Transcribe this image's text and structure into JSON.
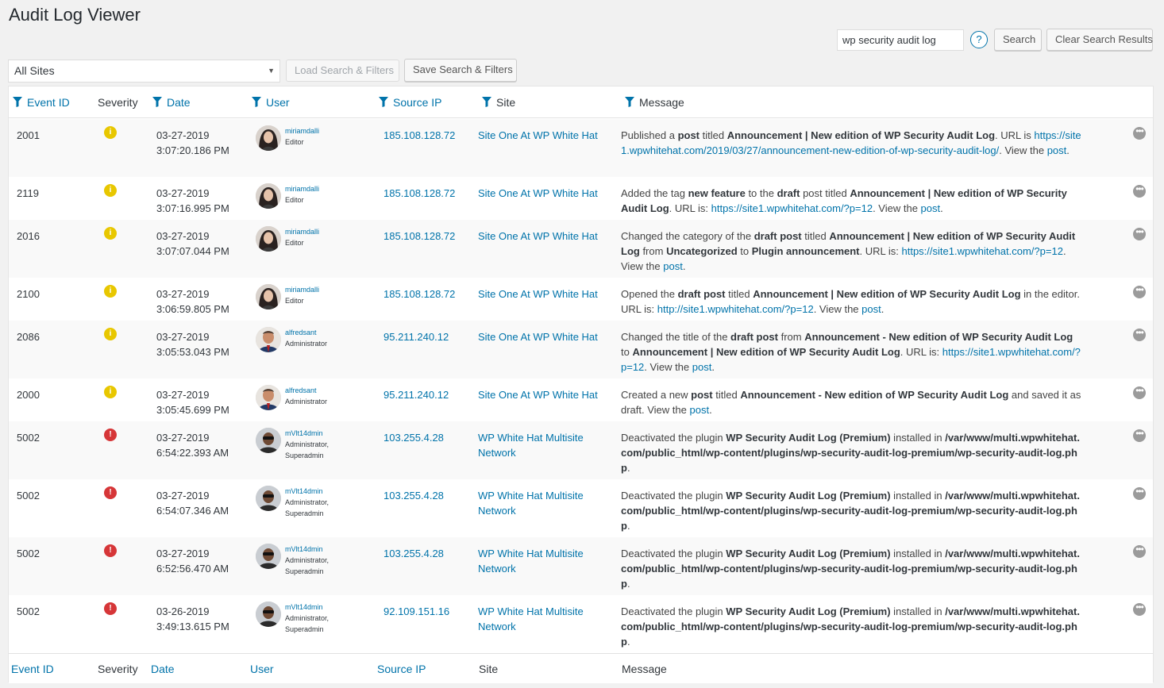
{
  "header": {
    "title": "Audit Log Viewer"
  },
  "search": {
    "value": "wp security audit log",
    "help_label": "?",
    "search_label": "Search",
    "clear_label": "Clear Search Results"
  },
  "filters": {
    "site_select": "All Sites",
    "load_label": "Load Search & Filters",
    "save_label": "Save Search & Filters"
  },
  "columns": {
    "event_id": "Event ID",
    "severity": "Severity",
    "date": "Date",
    "user": "User",
    "source_ip": "Source IP",
    "site": "Site",
    "message": "Message"
  },
  "colors": {
    "link": "#0073aa",
    "info": "#e8c700",
    "critical": "#d63638"
  },
  "rows": [
    {
      "id": "2001",
      "severity": "info",
      "sev_glyph": "i",
      "date": "03-27-2019",
      "time": "3:07:20.186 PM",
      "user": "miriamdalli",
      "role1": "Editor",
      "role2": "",
      "avatar": "woman-avatar",
      "ip": "185.108.128.72",
      "site1": "Site One At WP White Hat",
      "site2": "",
      "msg": [
        {
          "t": "Published a ",
          "s": "plain"
        },
        {
          "t": "post",
          "s": "bold"
        },
        {
          "t": " titled ",
          "s": "plain"
        },
        {
          "t": "Announcement | New edition of WP Security Audit Log",
          "s": "bold"
        },
        {
          "t": ". URL is ",
          "s": "plain"
        },
        {
          "t": "https://site1.wpwhitehat.com/2019/03/27/announcement-new-edition-of-wp-security-audit-log/",
          "s": "link"
        },
        {
          "t": ". View the ",
          "s": "plain"
        },
        {
          "t": "post",
          "s": "link"
        },
        {
          "t": ".",
          "s": "plain"
        }
      ]
    },
    {
      "id": "2119",
      "severity": "info",
      "sev_glyph": "i",
      "date": "03-27-2019",
      "time": "3:07:16.995 PM",
      "user": "miriamdalli",
      "role1": "Editor",
      "role2": "",
      "avatar": "woman-avatar",
      "ip": "185.108.128.72",
      "site1": "Site One At WP White Hat",
      "site2": "",
      "msg": [
        {
          "t": "Added the tag ",
          "s": "plain"
        },
        {
          "t": "new feature",
          "s": "bold"
        },
        {
          "t": " to the ",
          "s": "plain"
        },
        {
          "t": "draft",
          "s": "bold"
        },
        {
          "t": " post titled ",
          "s": "plain"
        },
        {
          "t": "Announcement | New edition of WP Security Audit Log",
          "s": "bold"
        },
        {
          "t": ". URL is: ",
          "s": "plain"
        },
        {
          "t": "https://site1.wpwhitehat.com/?p=12",
          "s": "link"
        },
        {
          "t": ". View the ",
          "s": "plain"
        },
        {
          "t": "post",
          "s": "link"
        },
        {
          "t": ".",
          "s": "plain"
        }
      ]
    },
    {
      "id": "2016",
      "severity": "info",
      "sev_glyph": "i",
      "date": "03-27-2019",
      "time": "3:07:07.044 PM",
      "user": "miriamdalli",
      "role1": "Editor",
      "role2": "",
      "avatar": "woman-avatar",
      "ip": "185.108.128.72",
      "site1": "Site One At WP White Hat",
      "site2": "",
      "msg": [
        {
          "t": "Changed the category of the ",
          "s": "plain"
        },
        {
          "t": "draft post",
          "s": "bold"
        },
        {
          "t": " titled ",
          "s": "plain"
        },
        {
          "t": "Announcement | New edition of WP Security Audit Log",
          "s": "bold"
        },
        {
          "t": " from ",
          "s": "plain"
        },
        {
          "t": "Uncategorized",
          "s": "bold"
        },
        {
          "t": " to ",
          "s": "plain"
        },
        {
          "t": "Plugin announcement",
          "s": "bold"
        },
        {
          "t": ". URL is: ",
          "s": "plain"
        },
        {
          "t": "https://site1.wpwhitehat.com/?p=12",
          "s": "link"
        },
        {
          "t": ". View the ",
          "s": "plain"
        },
        {
          "t": "post",
          "s": "link"
        },
        {
          "t": ".",
          "s": "plain"
        }
      ]
    },
    {
      "id": "2100",
      "severity": "info",
      "sev_glyph": "i",
      "date": "03-27-2019",
      "time": "3:06:59.805 PM",
      "user": "miriamdalli",
      "role1": "Editor",
      "role2": "",
      "avatar": "woman-avatar",
      "ip": "185.108.128.72",
      "site1": "Site One At WP White Hat",
      "site2": "",
      "msg": [
        {
          "t": "Opened the ",
          "s": "plain"
        },
        {
          "t": "draft post",
          "s": "bold"
        },
        {
          "t": " titled ",
          "s": "plain"
        },
        {
          "t": "Announcement | New edition of WP Security Audit Log",
          "s": "bold"
        },
        {
          "t": " in the editor. URL is: ",
          "s": "plain"
        },
        {
          "t": "http://site1.wpwhitehat.com/?p=12",
          "s": "link"
        },
        {
          "t": ". View the ",
          "s": "plain"
        },
        {
          "t": "post",
          "s": "link"
        },
        {
          "t": ".",
          "s": "plain"
        }
      ]
    },
    {
      "id": "2086",
      "severity": "info",
      "sev_glyph": "i",
      "date": "03-27-2019",
      "time": "3:05:53.043 PM",
      "user": "alfredsant",
      "role1": "Administrator",
      "role2": "",
      "avatar": "man-avatar",
      "ip": "95.211.240.12",
      "site1": "Site One At WP White Hat",
      "site2": "",
      "msg": [
        {
          "t": "Changed the title of the ",
          "s": "plain"
        },
        {
          "t": "draft post",
          "s": "bold"
        },
        {
          "t": " from ",
          "s": "plain"
        },
        {
          "t": "Announcement - New edition of WP Security Audit Log",
          "s": "bold"
        },
        {
          "t": " to ",
          "s": "plain"
        },
        {
          "t": "Announcement | New edition of WP Security Audit Log",
          "s": "bold"
        },
        {
          "t": ". URL is: ",
          "s": "plain"
        },
        {
          "t": "https://site1.wpwhitehat.com/?p=12",
          "s": "link"
        },
        {
          "t": ". View the ",
          "s": "plain"
        },
        {
          "t": "post",
          "s": "link"
        },
        {
          "t": ".",
          "s": "plain"
        }
      ]
    },
    {
      "id": "2000",
      "severity": "info",
      "sev_glyph": "i",
      "date": "03-27-2019",
      "time": "3:05:45.699 PM",
      "user": "alfredsant",
      "role1": "Administrator",
      "role2": "",
      "avatar": "man-avatar",
      "ip": "95.211.240.12",
      "site1": "Site One At WP White Hat",
      "site2": "",
      "msg": [
        {
          "t": "Created a new ",
          "s": "plain"
        },
        {
          "t": "post",
          "s": "bold"
        },
        {
          "t": " titled ",
          "s": "plain"
        },
        {
          "t": "Announcement - New edition of WP Security Audit Log",
          "s": "bold"
        },
        {
          "t": " and saved it as draft. View the ",
          "s": "plain"
        },
        {
          "t": "post",
          "s": "link"
        },
        {
          "t": ".",
          "s": "plain"
        }
      ]
    },
    {
      "id": "5002",
      "severity": "critical",
      "sev_glyph": "!",
      "date": "03-27-2019",
      "time": "6:54:22.393 AM",
      "user": "mVlt14dmin",
      "role1": "Administrator,",
      "role2": "Superadmin",
      "avatar": "admin-avatar",
      "ip": "103.255.4.28",
      "site1": "WP White Hat Multisite",
      "site2": "Network",
      "msg": [
        {
          "t": "Deactivated the plugin ",
          "s": "plain"
        },
        {
          "t": "WP Security Audit Log (Premium)",
          "s": "bold"
        },
        {
          "t": " installed in ",
          "s": "plain"
        },
        {
          "t": "/var/www/multi.wpwhitehat.com/public_html/wp-content/plugins/wp-security-audit-log-premium/wp-security-audit-log.php",
          "s": "bold"
        },
        {
          "t": ".",
          "s": "plain"
        }
      ]
    },
    {
      "id": "5002",
      "severity": "critical",
      "sev_glyph": "!",
      "date": "03-27-2019",
      "time": "6:54:07.346 AM",
      "user": "mVlt14dmin",
      "role1": "Administrator,",
      "role2": "Superadmin",
      "avatar": "admin-avatar",
      "ip": "103.255.4.28",
      "site1": "WP White Hat Multisite",
      "site2": "Network",
      "msg": [
        {
          "t": "Deactivated the plugin ",
          "s": "plain"
        },
        {
          "t": "WP Security Audit Log (Premium)",
          "s": "bold"
        },
        {
          "t": " installed in ",
          "s": "plain"
        },
        {
          "t": "/var/www/multi.wpwhitehat.com/public_html/wp-content/plugins/wp-security-audit-log-premium/wp-security-audit-log.php",
          "s": "bold"
        },
        {
          "t": ".",
          "s": "plain"
        }
      ]
    },
    {
      "id": "5002",
      "severity": "critical",
      "sev_glyph": "!",
      "date": "03-27-2019",
      "time": "6:52:56.470 AM",
      "user": "mVlt14dmin",
      "role1": "Administrator,",
      "role2": "Superadmin",
      "avatar": "admin-avatar",
      "ip": "103.255.4.28",
      "site1": "WP White Hat Multisite",
      "site2": "Network",
      "msg": [
        {
          "t": "Deactivated the plugin ",
          "s": "plain"
        },
        {
          "t": "WP Security Audit Log (Premium)",
          "s": "bold"
        },
        {
          "t": " installed in ",
          "s": "plain"
        },
        {
          "t": "/var/www/multi.wpwhitehat.com/public_html/wp-content/plugins/wp-security-audit-log-premium/wp-security-audit-log.php",
          "s": "bold"
        },
        {
          "t": ".",
          "s": "plain"
        }
      ]
    },
    {
      "id": "5002",
      "severity": "critical",
      "sev_glyph": "!",
      "date": "03-26-2019",
      "time": "3:49:13.615 PM",
      "user": "mVlt14dmin",
      "role1": "Administrator,",
      "role2": "Superadmin",
      "avatar": "admin-avatar",
      "ip": "92.109.151.16",
      "site1": "WP White Hat Multisite",
      "site2": "Network",
      "msg": [
        {
          "t": "Deactivated the plugin ",
          "s": "plain"
        },
        {
          "t": "WP Security Audit Log (Premium)",
          "s": "bold"
        },
        {
          "t": " installed in ",
          "s": "plain"
        },
        {
          "t": "/var/www/multi.wpwhitehat.com/public_html/wp-content/plugins/wp-security-audit-log-premium/wp-security-audit-log.php",
          "s": "bold"
        },
        {
          "t": ".",
          "s": "plain"
        }
      ]
    }
  ]
}
